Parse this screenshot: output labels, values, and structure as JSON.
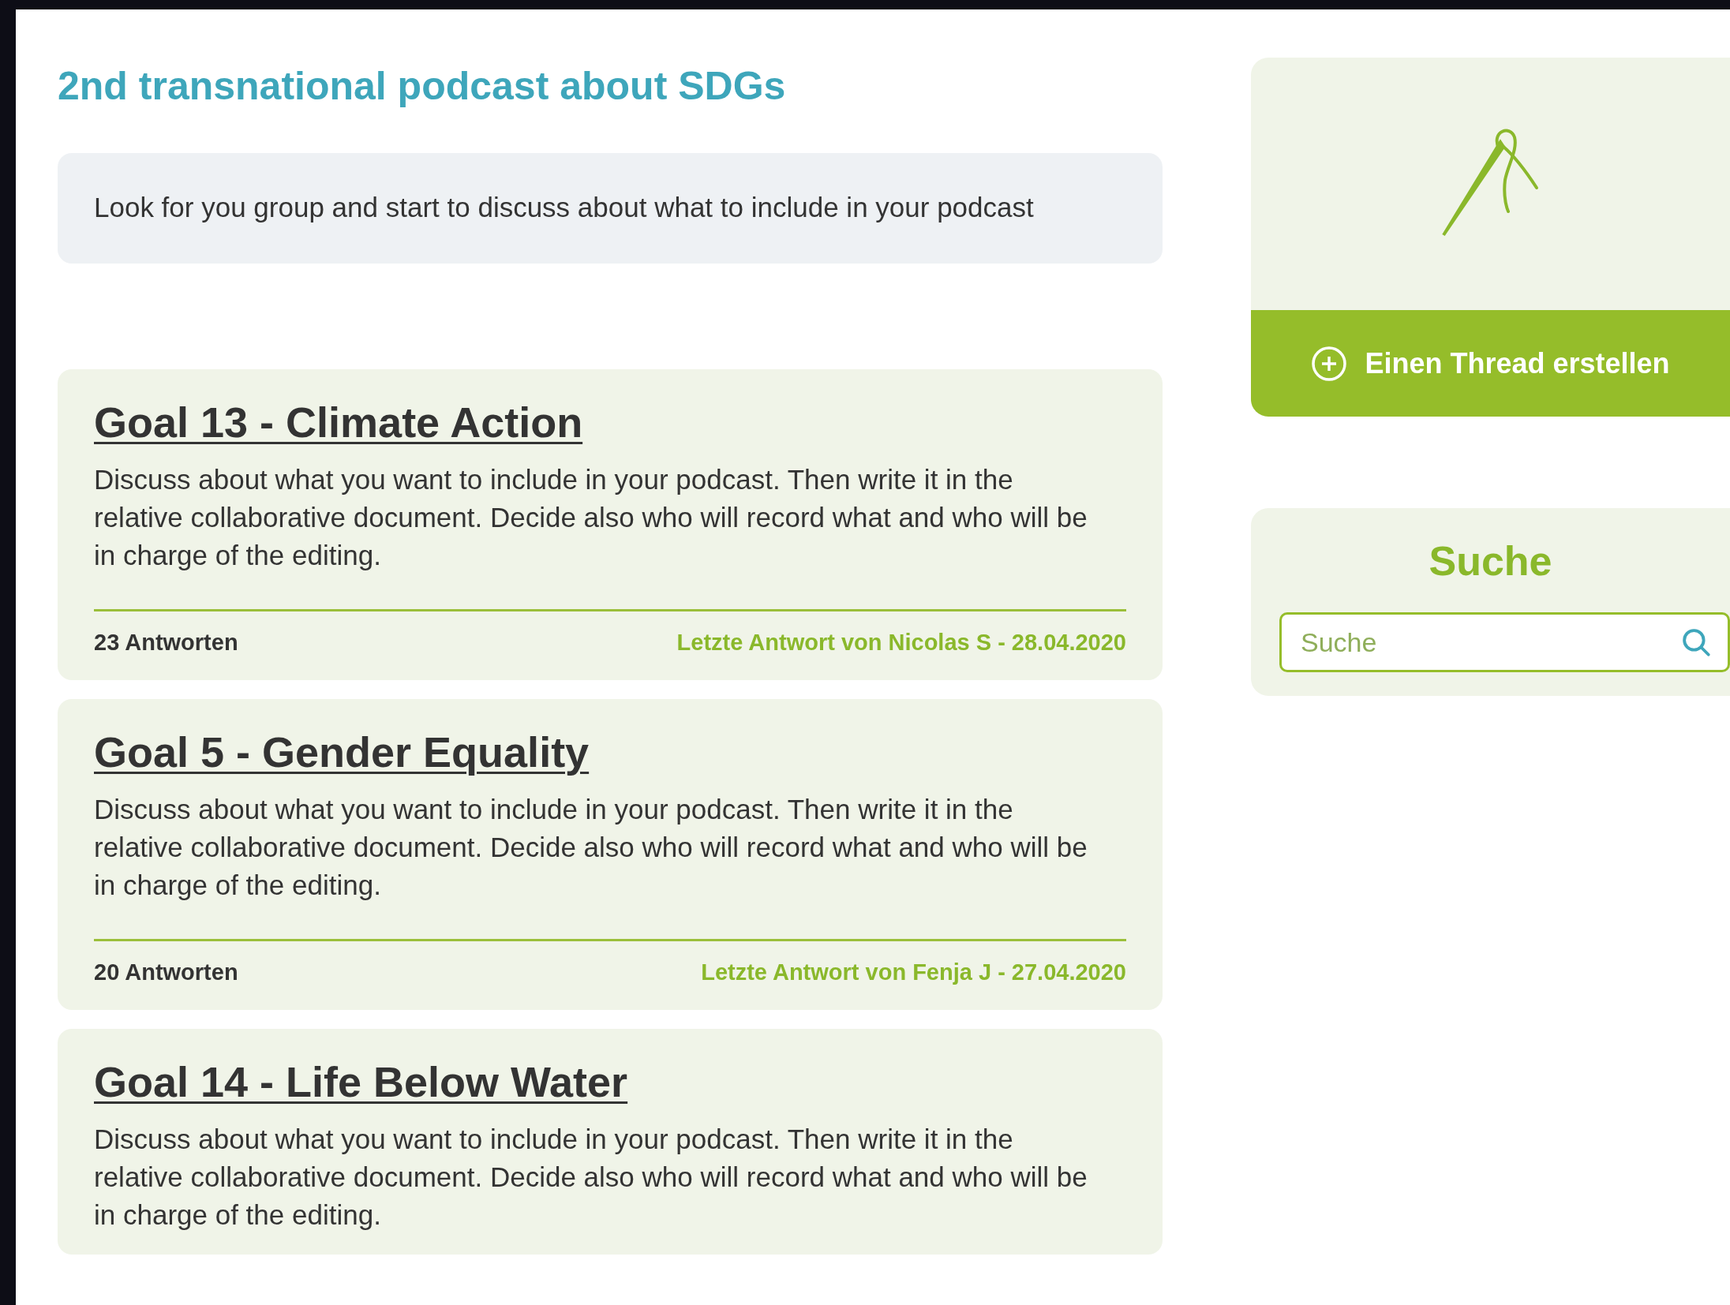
{
  "page_title": "2nd transnational podcast about SDGs",
  "intro": "Look for you group and start to discuss about what to include in your podcast",
  "threads": [
    {
      "title": "Goal 13 - Climate Action",
      "description": "Discuss about what you want to include in your podcast. Then write it in the relative collaborative document. Decide also who will record what and who will be in charge of the editing.",
      "replies": "23 Antworten",
      "last_reply": "Letzte Antwort von Nicolas S - 28.04.2020"
    },
    {
      "title": "Goal 5 - Gender Equality",
      "description": "Discuss about what you want to include in your podcast. Then write it in the relative collaborative document. Decide also who will record what and who will be in charge of the editing.",
      "replies": "20 Antworten",
      "last_reply": "Letzte Antwort von Fenja J - 27.04.2020"
    },
    {
      "title": "Goal 14 - Life Below Water",
      "description": "Discuss about what you want to include in your podcast. Then write it in the relative collaborative document. Decide also who will record what and who will be in charge of the editing."
    }
  ],
  "create_thread_button": "Einen Thread erstellen",
  "search": {
    "heading": "Suche",
    "placeholder": "Suche"
  }
}
